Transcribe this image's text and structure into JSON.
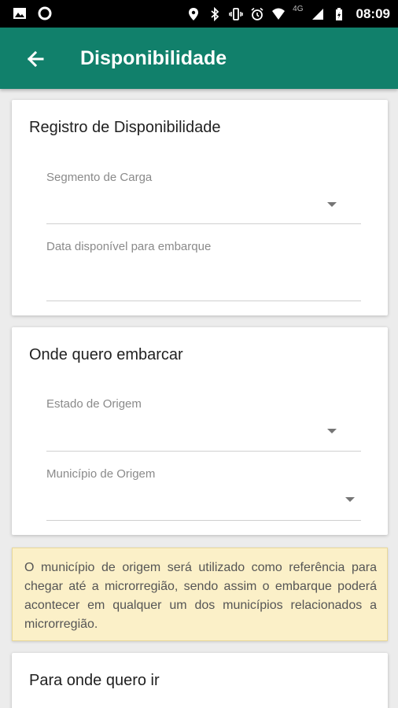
{
  "status_bar": {
    "time": "08:09",
    "network": "4G",
    "icons": [
      "image-icon",
      "circle-icon",
      "location-icon",
      "bluetooth-icon",
      "vibrate-icon",
      "alarm-icon",
      "wifi-icon",
      "signal-icon",
      "battery-icon"
    ]
  },
  "app_bar": {
    "title": "Disponibilidade",
    "back_icon": "arrow-back-icon",
    "color": "#11806b"
  },
  "card_registro": {
    "title": "Registro de Disponibilidade",
    "fields": [
      {
        "label": "Segmento de Carga",
        "type": "dropdown",
        "value": ""
      },
      {
        "label": "Data disponível para embarque",
        "type": "date",
        "value": ""
      }
    ]
  },
  "card_origem": {
    "title": "Onde quero embarcar",
    "fields": [
      {
        "label": "Estado de Origem",
        "type": "dropdown",
        "value": ""
      },
      {
        "label": "Município de Origem",
        "type": "dropdown",
        "value": ""
      }
    ]
  },
  "info_box": {
    "text": "O município de origem será utilizado como referência para chegar até a microrregião, sendo assim o embarque poderá acontecer em qualquer um dos municípios relacionados a microrregião.",
    "background": "#fbf0c8"
  },
  "card_destino": {
    "title": "Para onde quero ir"
  }
}
